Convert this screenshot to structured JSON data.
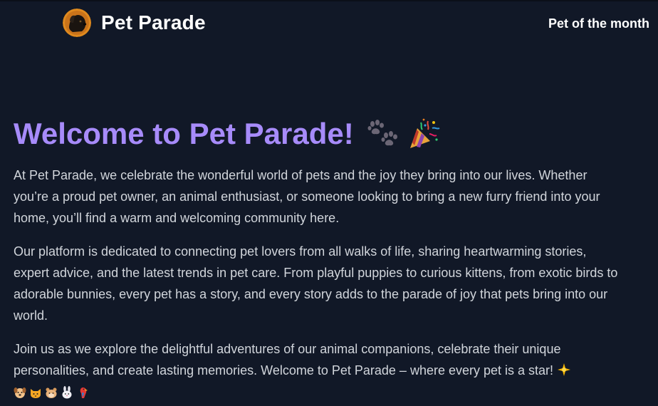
{
  "header": {
    "brand": "Pet Parade",
    "nav_link": "Pet of the month",
    "logo_icon": "dog-avatar-icon"
  },
  "main": {
    "title": "Welcome to Pet Parade!",
    "title_icons": [
      "paw-prints-icon",
      "party-popper-icon"
    ],
    "paragraphs": {
      "p1": "At Pet Parade, we celebrate the wonderful world of pets and the joy they bring into our lives. Whether you’re a proud pet owner, an animal enthusiast, or someone looking to bring a new furry friend into your home, you’ll find a warm and welcoming community here.",
      "p2": "Our platform is dedicated to connecting pet lovers from all walks of life, sharing heartwarming stories, expert advice, and the latest trends in pet care. From playful puppies to curious kittens, from exotic birds to adorable bunnies, every pet has a story, and every story adds to the parade of joy that pets bring into our world.",
      "p3": "Join us as we explore the delightful adventures of our animal companions, celebrate their unique personalities, and create lasting memories. Welcome to Pet Parade – where every pet is a star!"
    },
    "trailing_icons": [
      "glowing-star-icon",
      "dog-face-icon",
      "cat-face-icon",
      "hamster-face-icon",
      "rabbit-face-icon",
      "parrot-icon"
    ]
  },
  "colors": {
    "background": "#111827",
    "title": "#a78bfa",
    "body_text": "#d1d5db",
    "header_text": "#ffffff"
  }
}
